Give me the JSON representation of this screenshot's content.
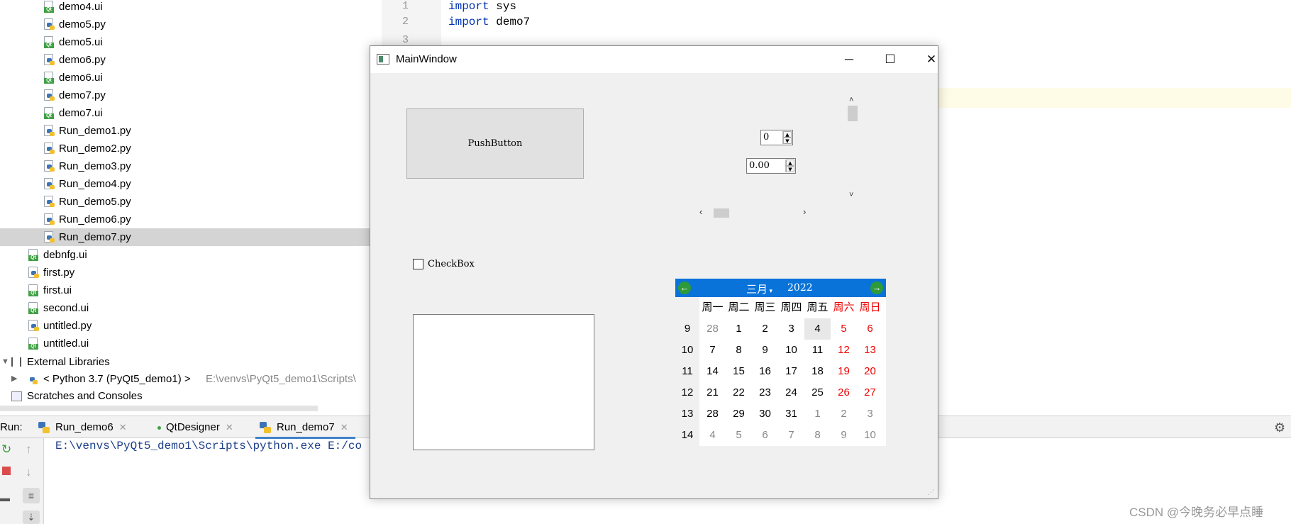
{
  "project_tree": {
    "items": [
      {
        "label": "demo4.ui",
        "type": "ui",
        "indent": 2
      },
      {
        "label": "demo5.py",
        "type": "py",
        "indent": 2
      },
      {
        "label": "demo5.ui",
        "type": "ui",
        "indent": 2
      },
      {
        "label": "demo6.py",
        "type": "py",
        "indent": 2
      },
      {
        "label": "demo6.ui",
        "type": "ui",
        "indent": 2
      },
      {
        "label": "demo7.py",
        "type": "py",
        "indent": 2
      },
      {
        "label": "demo7.ui",
        "type": "ui",
        "indent": 2
      },
      {
        "label": "Run_demo1.py",
        "type": "py",
        "indent": 2
      },
      {
        "label": "Run_demo2.py",
        "type": "py",
        "indent": 2
      },
      {
        "label": "Run_demo3.py",
        "type": "py",
        "indent": 2
      },
      {
        "label": "Run_demo4.py",
        "type": "py",
        "indent": 2
      },
      {
        "label": "Run_demo5.py",
        "type": "py",
        "indent": 2
      },
      {
        "label": "Run_demo6.py",
        "type": "py",
        "indent": 2
      },
      {
        "label": "Run_demo7.py",
        "type": "py",
        "indent": 2,
        "selected": true
      },
      {
        "label": "debnfg.ui",
        "type": "ui",
        "indent": 1
      },
      {
        "label": "first.py",
        "type": "py",
        "indent": 1
      },
      {
        "label": "first.ui",
        "type": "ui",
        "indent": 1
      },
      {
        "label": "second.ui",
        "type": "ui",
        "indent": 1
      },
      {
        "label": "untitled.py",
        "type": "py",
        "indent": 1
      },
      {
        "label": "untitled.ui",
        "type": "ui",
        "indent": 1
      }
    ],
    "external_libraries": "External Libraries",
    "python_sdk": "< Python 3.7 (PyQt5_demo1) >",
    "python_sdk_path": "E:\\venvs\\PyQt5_demo1\\Scripts\\",
    "scratches": "Scratches and Consoles"
  },
  "editor": {
    "line_numbers": [
      "1",
      "2",
      "3"
    ],
    "lines": [
      {
        "kw": "import",
        "rest": " sys"
      },
      {
        "kw": "import",
        "rest": " demo7"
      }
    ]
  },
  "run_panel": {
    "label": "Run:",
    "tabs": [
      {
        "label": "Run_demo6"
      },
      {
        "label": "QtDesigner"
      },
      {
        "label": "Run_demo7",
        "active": true
      }
    ],
    "console_line": "E:\\venvs\\PyQt5_demo1\\Scripts\\python.exe E:/co"
  },
  "main_window": {
    "title": "MainWindow",
    "push_button": "PushButton",
    "spin_int": "0",
    "spin_double": "0.00",
    "checkbox": "CheckBox",
    "vertical_scrollbar_value": 0,
    "horizontal_scrollbar_value": 0,
    "calendar": {
      "month": "三月",
      "year": "2022",
      "weekdays": [
        "周一",
        "周二",
        "周三",
        "周四",
        "周五",
        "周六",
        "周日"
      ],
      "weeks": [
        {
          "num": "9",
          "days": [
            "28",
            "1",
            "2",
            "3",
            "4",
            "5",
            "6"
          ]
        },
        {
          "num": "10",
          "days": [
            "7",
            "8",
            "9",
            "10",
            "11",
            "12",
            "13"
          ]
        },
        {
          "num": "11",
          "days": [
            "14",
            "15",
            "16",
            "17",
            "18",
            "19",
            "20"
          ]
        },
        {
          "num": "12",
          "days": [
            "21",
            "22",
            "23",
            "24",
            "25",
            "26",
            "27"
          ]
        },
        {
          "num": "13",
          "days": [
            "28",
            "29",
            "30",
            "31",
            "1",
            "2",
            "3"
          ]
        },
        {
          "num": "14",
          "days": [
            "4",
            "5",
            "6",
            "7",
            "8",
            "9",
            "10"
          ]
        }
      ],
      "selected_day": "4"
    }
  },
  "watermark": "CSDN @今晚务必早点睡",
  "colors": {
    "calendar_nav": "#0a73d9",
    "weekend": "#e00000",
    "selection": "#d4d4d4",
    "keyword": "#0033b3"
  }
}
